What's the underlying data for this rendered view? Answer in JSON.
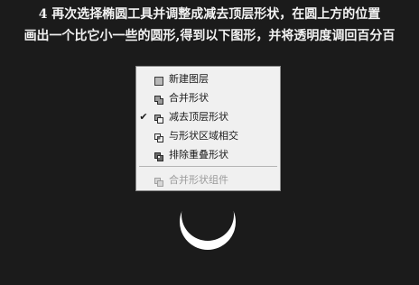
{
  "caption": {
    "line1": "4 再次选择椭圆工具并调整成减去顶层形状，在圆上方的位置",
    "line2": "画出一个比它小一些的圆形,得到以下图形，并将透明度调回百分百"
  },
  "menu": {
    "items": [
      {
        "label": "新建图层",
        "icon": "new-layer-icon",
        "checked": "",
        "enabled": true
      },
      {
        "label": "合并形状",
        "icon": "combine-shapes-icon",
        "checked": "",
        "enabled": true
      },
      {
        "label": "减去顶层形状",
        "icon": "subtract-front-shape-icon",
        "checked": "✔",
        "enabled": true
      },
      {
        "label": "与形状区域相交",
        "icon": "intersect-shape-areas-icon",
        "checked": "",
        "enabled": true
      },
      {
        "label": "排除重叠形状",
        "icon": "exclude-overlapping-shapes-icon",
        "checked": "",
        "enabled": true
      },
      {
        "label": "合并形状组件",
        "icon": "merge-shape-components-icon",
        "checked": "",
        "enabled": false
      }
    ]
  },
  "colors": {
    "background": "#1b1b1b",
    "menu_background": "#f0f0f0",
    "shape_fill": "#ffffff"
  }
}
